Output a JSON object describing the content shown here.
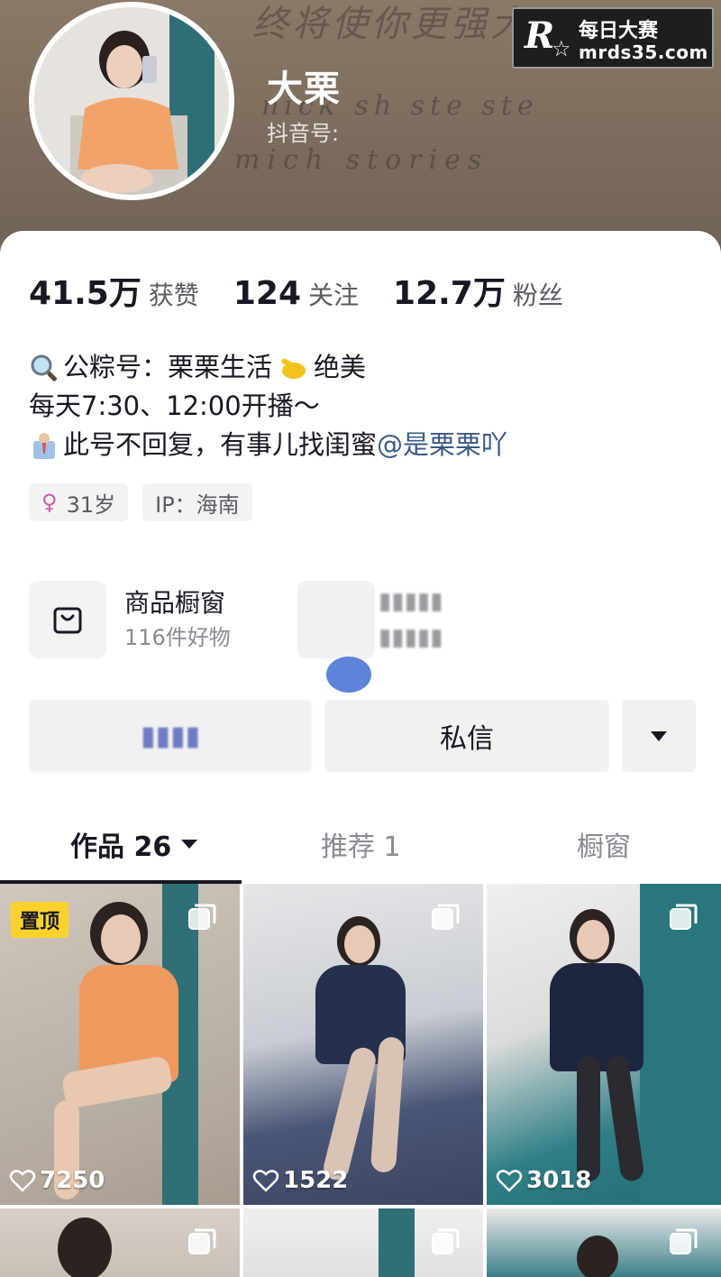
{
  "profile": {
    "name": "大栗",
    "id_label": "抖音号:"
  },
  "watermark": {
    "logo": "R",
    "title": "每日大赛",
    "domain": "mrds35.com"
  },
  "stats": [
    {
      "value": "41.5万",
      "label": "获赞"
    },
    {
      "value": "124",
      "label": "关注"
    },
    {
      "value": "12.7万",
      "label": "粉丝"
    }
  ],
  "bio": {
    "line1": "公粽号：栗栗生活",
    "line1_tail": "绝美",
    "line2": "每天7:30、12:00开播～",
    "line3": "此号不回复，有事儿找闺蜜",
    "line3_mention": "@是栗栗吖"
  },
  "tags": {
    "age": "31岁",
    "ip": "IP：海南"
  },
  "shop": {
    "title": "商品橱窗",
    "subtitle": "116件好物"
  },
  "actions": {
    "message": "私信"
  },
  "tabs": {
    "works": "作品 26",
    "recommend": "推荐 1",
    "showcase": "橱窗"
  },
  "videos": [
    {
      "likes": "7250",
      "pinned": "置顶"
    },
    {
      "likes": "1522"
    },
    {
      "likes": "3018"
    }
  ],
  "colors": {
    "banner": "#7b6b5c",
    "mention": "#3a5a85",
    "pin_badge": "#fbd22c",
    "tab_active": "#161823"
  }
}
